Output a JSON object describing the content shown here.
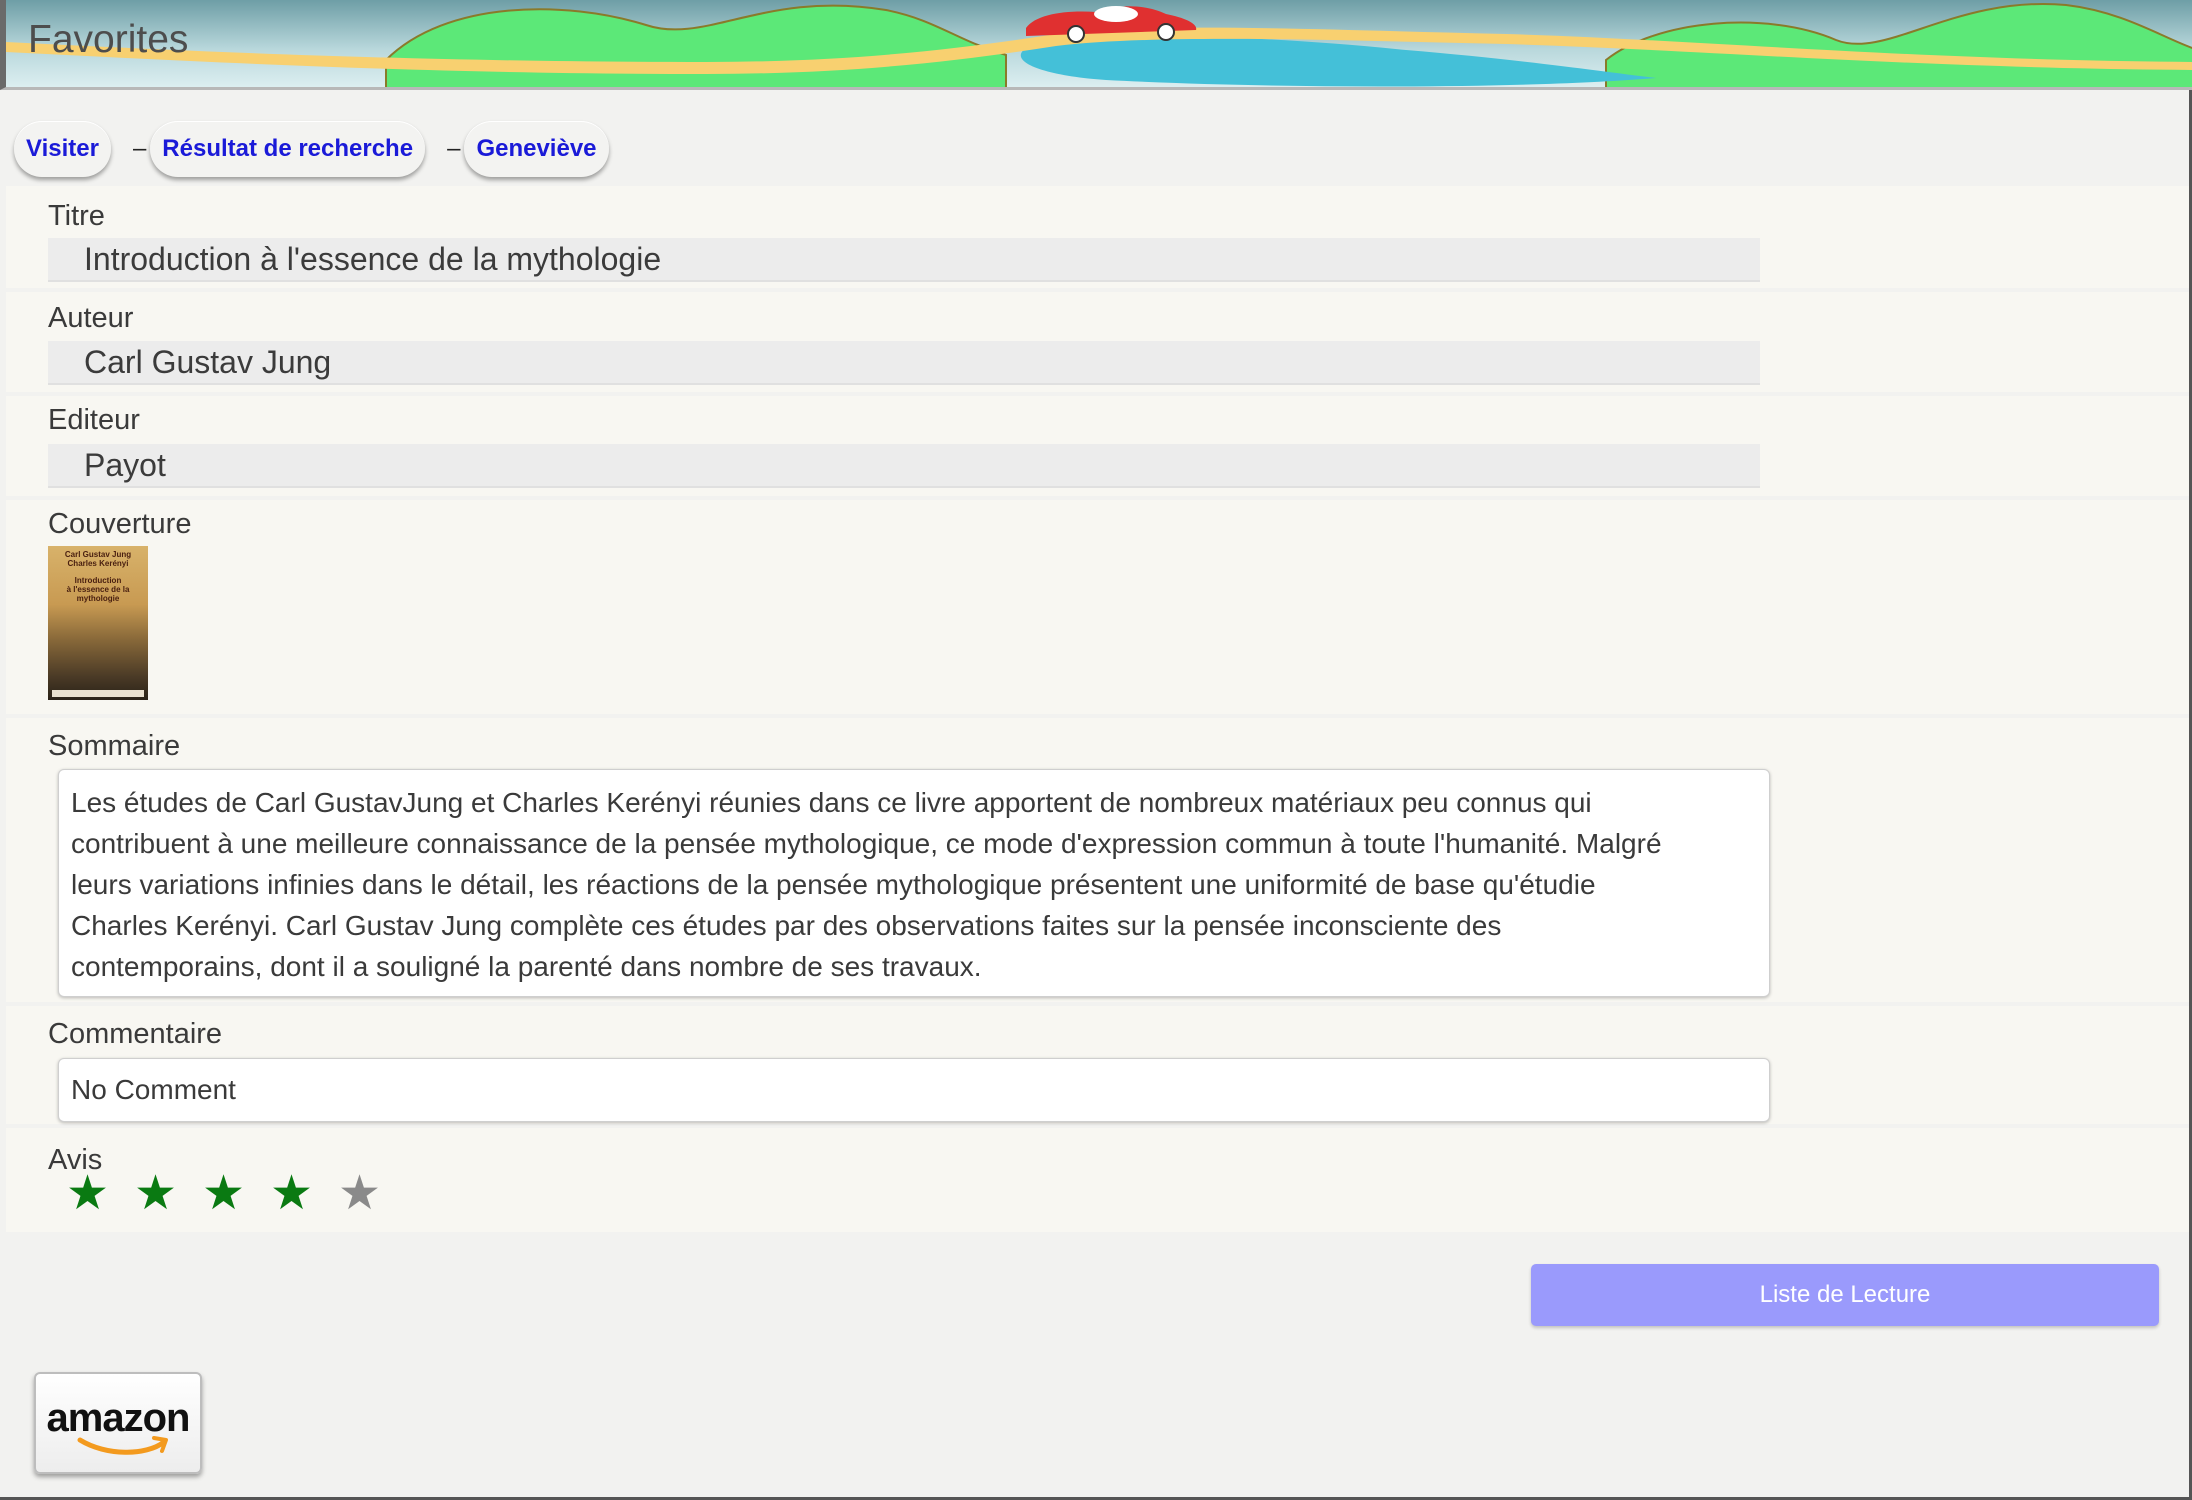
{
  "header": {
    "title": "Favorites"
  },
  "breadcrumb": {
    "items": [
      "Visiter",
      "Résultat de recherche",
      "Geneviève"
    ],
    "separator": "–"
  },
  "fields": {
    "title": {
      "label": "Titre",
      "value": "Introduction à l'essence de la mythologie"
    },
    "author": {
      "label": "Auteur",
      "value": "Carl Gustav Jung"
    },
    "publisher": {
      "label": "Editeur",
      "value": "Payot"
    },
    "cover": {
      "label": "Couverture",
      "cover_text": [
        "Carl Gustav Jung",
        "Charles Kerényi",
        "Introduction",
        "à l'essence de la",
        "mythologie"
      ]
    },
    "summary": {
      "label": "Sommaire",
      "lines": [
        "Les études de Carl GustavJung et Charles Kerényi réunies dans ce livre apportent de nombreux matériaux peu connus qui",
        "contribuent à une meilleure connaissance de la pensée mythologique, ce mode d'expression commun à toute l'humanité. Malgré",
        "leurs variations infinies dans le détail, les réactions de la pensée mythologique présentent une uniformité de base qu'étudie",
        "Charles Kerényi. Carl Gustav Jung complète ces études par des observations faites sur la pensée inconsciente des",
        "contemporains, dont il a souligné la parenté dans nombre de ses travaux."
      ]
    },
    "comment": {
      "label": "Commentaire",
      "value": "No Comment"
    },
    "rating": {
      "label": "Avis",
      "value": 4,
      "max": 5,
      "glyph": "★"
    }
  },
  "buttons": {
    "reading_list": "Liste de Lecture"
  },
  "amazon": {
    "label": "amazon",
    "icon": "amazon-logo"
  },
  "colors": {
    "link": "#1a1ad8",
    "star_filled": "#0a7a12",
    "star_empty": "#8a8a8a",
    "button_bg": "#9a9afc"
  }
}
